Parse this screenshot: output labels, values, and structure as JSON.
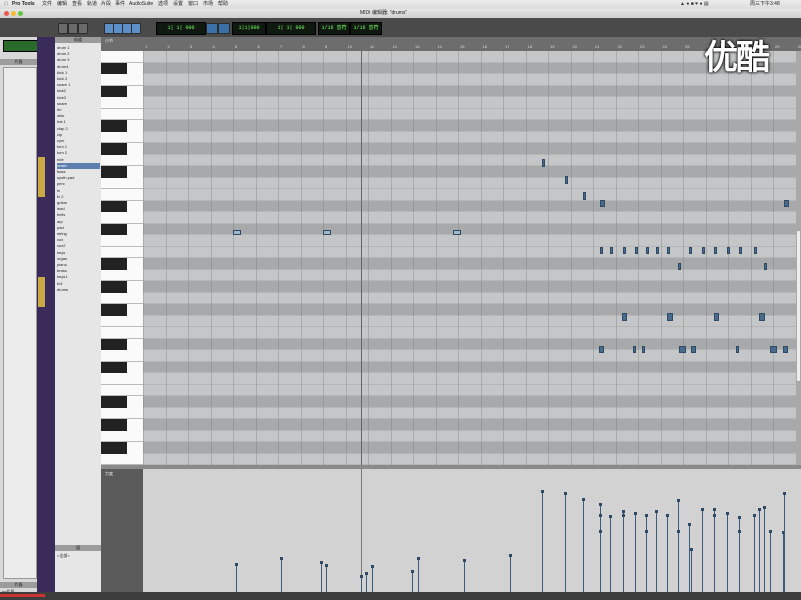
{
  "menu": {
    "app": "Pro Tools",
    "items": [
      "文件",
      "编辑",
      "查看",
      "轨道",
      "片段",
      "事件",
      "AudioSuite",
      "选项",
      "设置",
      "窗口",
      "市场",
      "帮助"
    ],
    "clock": "周三下午3:48"
  },
  "window": {
    "title": "MIDI 编辑器: \"drums\""
  },
  "watermark": "优酷",
  "clips_panel": {
    "header": "片段",
    "footer": "片段",
    "footer_item": "nd片段"
  },
  "tracks_panel": {
    "header": "轨道",
    "items": [
      "drum 1",
      "drum 2",
      "drum 3",
      "drum4",
      "kick 1",
      "kick 2",
      "snare 1",
      "kick2",
      "kick3",
      "snare",
      "hh",
      "shkr",
      "hat 1",
      "clap 2",
      "clp",
      "cym",
      "tom 1",
      "tom 2",
      "ride",
      "crash",
      "bass",
      "synth pad",
      "perc",
      "fx",
      "fx 2",
      "guitar",
      "lead",
      "bells",
      "arp",
      "pad",
      "string",
      "vox",
      "vox2",
      "keys",
      "organ",
      "piano",
      "brass",
      "keys1",
      "fx3",
      "drums"
    ],
    "footer": "组",
    "footer_item": "<全部>"
  },
  "toolbar": {
    "counter_main": "1|1|000",
    "counter_sub": "0:00",
    "start": "1| 1| 000",
    "end": "1| 1| 000",
    "grid": "1/16 音符",
    "nudge": "1/16 音符"
  },
  "ruler": {
    "label": "小节",
    "bars": [
      "1",
      "2",
      "3",
      "4",
      "5",
      "6",
      "7",
      "8",
      "9",
      "10",
      "11",
      "12",
      "13",
      "14",
      "15",
      "16",
      "17",
      "18",
      "19",
      "20",
      "21",
      "22",
      "23",
      "24",
      "25",
      "26",
      "27",
      "28",
      "29",
      "30"
    ]
  },
  "velocity_lane": {
    "label": "力度"
  },
  "colors": {
    "note": "#4a6a8a",
    "toolbar": "#4a4a4a",
    "lcd_text": "#7dff6a"
  }
}
